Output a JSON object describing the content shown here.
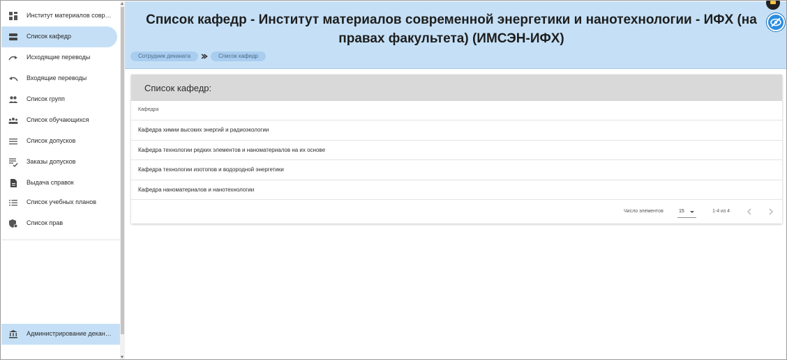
{
  "sidebar": {
    "items": [
      {
        "label": "Институт материалов совре…",
        "icon": "dashboard-icon",
        "active": false
      },
      {
        "label": "Список кафедр",
        "icon": "storage-icon",
        "active": true
      },
      {
        "label": "Исходящие переводы",
        "icon": "redo-icon",
        "active": false
      },
      {
        "label": "Входящие переводы",
        "icon": "undo-icon",
        "active": false
      },
      {
        "label": "Список групп",
        "icon": "people-icon",
        "active": false
      },
      {
        "label": "Список обучающихся",
        "icon": "groups-icon",
        "active": false
      },
      {
        "label": "Список допусков",
        "icon": "menu-icon",
        "active": false
      },
      {
        "label": "Заказы допусков",
        "icon": "checklist-icon",
        "active": false
      },
      {
        "label": "Выдача справок",
        "icon": "document-icon",
        "active": false
      },
      {
        "label": "Список учебных планов",
        "icon": "list-icon",
        "active": false
      },
      {
        "label": "Список прав",
        "icon": "admin-shield-icon",
        "active": false
      }
    ],
    "admin": {
      "label": "Администрирование деканата",
      "icon": "bank-icon"
    }
  },
  "header": {
    "title": "Список кафедр - Институт материалов современной энергетики и нанотехнологии - ИФХ (на правах факультета) (ИМСЭН-ИФХ)",
    "breadcrumbs": [
      "Сотрудник деканата",
      "Список кафедр"
    ],
    "toggle_icon": "eye-off-icon"
  },
  "card": {
    "title": "Список кафедр:",
    "column_header": "Кафедра",
    "rows": [
      "Кафедра химии высоких энергий и радиоэкологии",
      "Кафедра технологии редких элементов и наноматериалов на их основе",
      "Кафедра технологии изотопов и водородной энергетики",
      "Кафедра наноматериалов и нанотехнологии"
    ]
  },
  "paginator": {
    "label": "Число элементов",
    "page_size": "15",
    "range": "1-4 из 4"
  },
  "colors": {
    "accent": "#c5e0f6",
    "breadcrumb": "#a9cdef",
    "card_header": "#d9d9d9",
    "toggle": "#2a8de0"
  }
}
